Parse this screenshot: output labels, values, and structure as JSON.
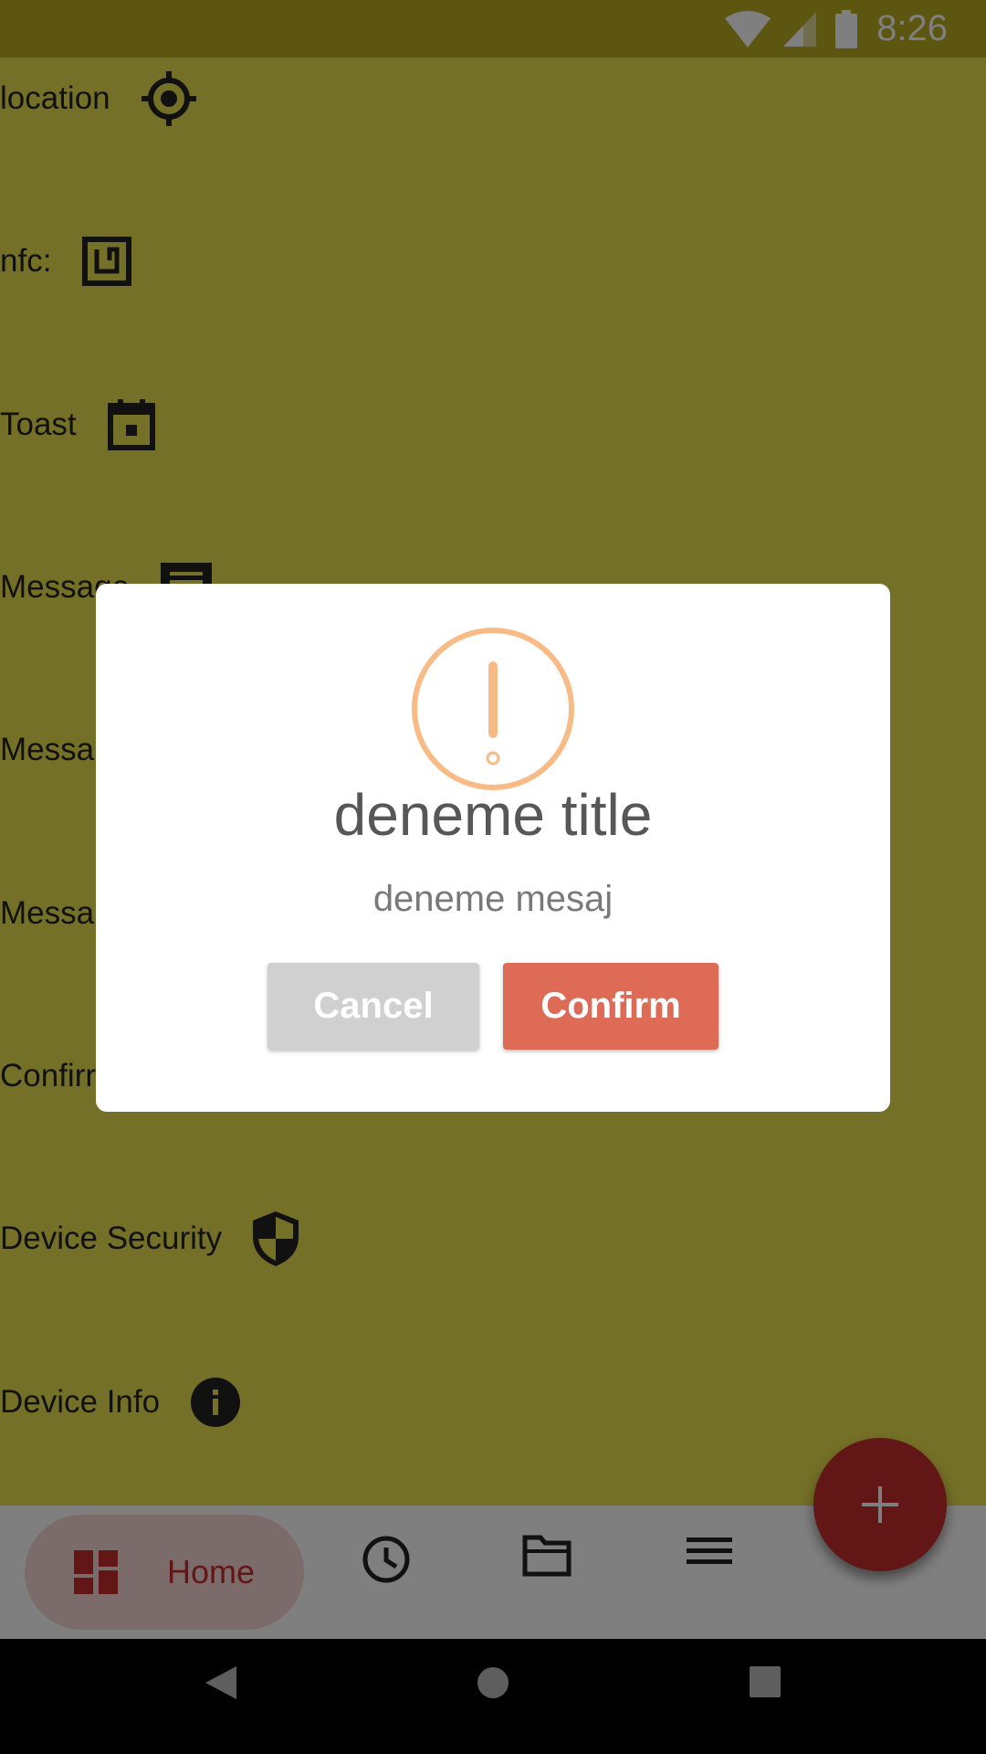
{
  "status_bar": {
    "time": "8:26",
    "icons": [
      "wifi-icon",
      "cell-signal-icon",
      "battery-icon"
    ]
  },
  "list": {
    "items": [
      {
        "label": "location",
        "icon": "gps-target-icon"
      },
      {
        "label": "nfc:",
        "icon": "nfc-icon"
      },
      {
        "label": "Toast",
        "icon": "calendar-icon"
      },
      {
        "label": "Message",
        "icon": "message-icon"
      },
      {
        "label": "Messa",
        "icon": ""
      },
      {
        "label": "Messa",
        "icon": ""
      },
      {
        "label": "Confirr",
        "icon": ""
      },
      {
        "label": "Device Security",
        "icon": "shield-icon"
      },
      {
        "label": "Device Info",
        "icon": "info-icon"
      }
    ]
  },
  "bottom_nav": {
    "home_label": "Home",
    "items": [
      "dashboard-icon",
      "clock-icon",
      "folder-icon",
      "menu-icon"
    ]
  },
  "fab": {
    "icon": "plus-icon"
  },
  "dialog": {
    "icon": "warning-icon",
    "title": "deneme title",
    "message": "deneme mesaj",
    "cancel_label": "Cancel",
    "confirm_label": "Confirm"
  },
  "colors": {
    "background": "#ebe04e",
    "accent": "#c62d2d",
    "warning": "#f8bb86",
    "confirm_button": "#dd6b55",
    "cancel_button": "#d0d0d0"
  }
}
